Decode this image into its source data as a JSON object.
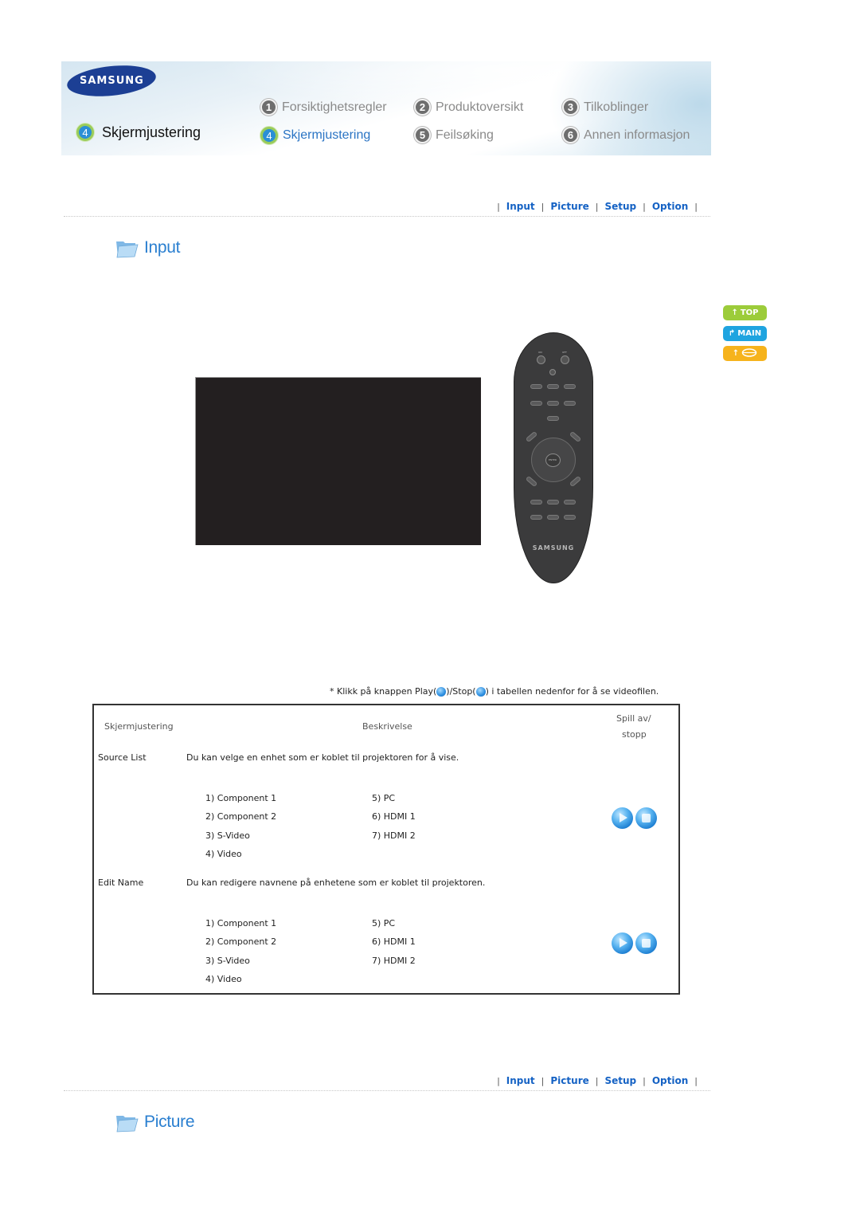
{
  "header": {
    "brand": "SAMSUNG",
    "current_chapter": {
      "number": "4",
      "label": "Skjermjustering"
    },
    "chapters": [
      {
        "number": "1",
        "label": "Forsiktighetsregler",
        "current": false
      },
      {
        "number": "2",
        "label": "Produktoversikt",
        "current": false
      },
      {
        "number": "3",
        "label": "Tilkoblinger",
        "current": false
      },
      {
        "number": "4",
        "label": "Skjermjustering",
        "current": true
      },
      {
        "number": "5",
        "label": "Feilsøking",
        "current": false
      },
      {
        "number": "6",
        "label": "Annen informasjon",
        "current": false
      }
    ]
  },
  "section_nav": {
    "separator": "|",
    "links": [
      "Input",
      "Picture",
      "Setup",
      "Option"
    ]
  },
  "side_buttons": {
    "top": "TOP",
    "main": "MAIN",
    "back_icon": "arrow-up-and-ring"
  },
  "sections": [
    {
      "title": "Input",
      "icon": "folder-icon"
    },
    {
      "title": "Picture",
      "icon": "folder-icon"
    }
  ],
  "remote": {
    "brand": "SAMSUNG",
    "labels": [
      "ON",
      "OFF",
      "ENTER"
    ]
  },
  "notice": {
    "prefix": "* Klikk på knappen Play(",
    "middle": ")/Stop(",
    "suffix": ") i tabellen nedenfor for å se videofilen."
  },
  "table": {
    "headers": {
      "col1": "Skjermjustering",
      "col2": "Beskrivelse",
      "col3_line1": "Spill av/",
      "col3_line2": "stopp"
    },
    "rows": [
      {
        "name": "Source List",
        "description": "Du kan velge en enhet som er koblet til projektoren for å vise.",
        "items_left": [
          "1) Component 1",
          "2) Component 2",
          "3) S-Video",
          "4) Video"
        ],
        "items_right": [
          "5) PC",
          "6) HDMI 1",
          "7) HDMI 2"
        ]
      },
      {
        "name": "Edit Name",
        "description": "Du kan redigere navnene på enhetene som er koblet til projektoren.",
        "items_left": [
          "1) Component 1",
          "2) Component 2",
          "3) S-Video",
          "4) Video"
        ],
        "items_right": [
          "5) PC",
          "6) HDMI 1",
          "7) HDMI 2"
        ]
      }
    ]
  },
  "colors": {
    "link_blue": "#1562c4",
    "title_blue": "#2a7fd0",
    "top_green": "#9ccc3a",
    "main_blue": "#1fa4e0",
    "back_orange": "#f6b31c"
  }
}
